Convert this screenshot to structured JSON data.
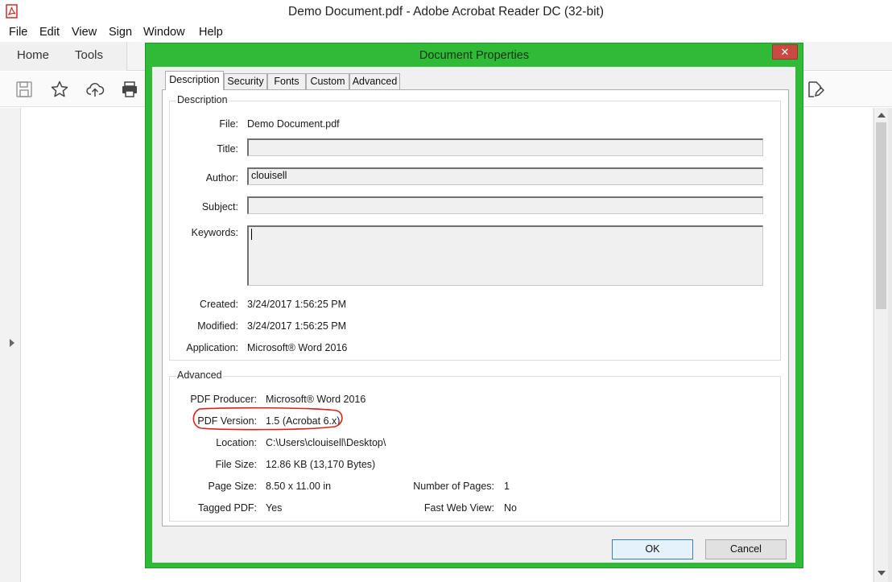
{
  "window": {
    "title": "Demo Document.pdf - Adobe Acrobat Reader DC (32-bit)"
  },
  "menu": [
    "File",
    "Edit",
    "View",
    "Sign",
    "Window",
    "Help"
  ],
  "tabs": {
    "home": "Home",
    "tools": "Tools"
  },
  "toolbar": {
    "icons": [
      "save-icon",
      "star-icon",
      "upload-cloud-icon",
      "print-icon",
      "edit-document-icon"
    ]
  },
  "dialog": {
    "title": "Document Properties",
    "accent_color": "#2fbb37",
    "close_label": "✕",
    "tabs": [
      "Description",
      "Security",
      "Fonts",
      "Custom",
      "Advanced"
    ],
    "active_tab": "Description",
    "description": {
      "group_label": "Description",
      "file_label": "File:",
      "file_value": "Demo Document.pdf",
      "title_label": "Title:",
      "title_value": "",
      "author_label": "Author:",
      "author_value": "clouisell",
      "subject_label": "Subject:",
      "subject_value": "",
      "keywords_label": "Keywords:",
      "keywords_value": "",
      "created_label": "Created:",
      "created_value": "3/24/2017 1:56:25 PM",
      "modified_label": "Modified:",
      "modified_value": "3/24/2017 1:56:25 PM",
      "application_label": "Application:",
      "application_value": "Microsoft® Word 2016"
    },
    "advanced": {
      "group_label": "Advanced",
      "producer_label": "PDF Producer:",
      "producer_value": "Microsoft® Word 2016",
      "version_label": "PDF Version:",
      "version_value": "1.5 (Acrobat 6.x)",
      "location_label": "Location:",
      "location_value": "C:\\Users\\clouisell\\Desktop\\",
      "filesize_label": "File Size:",
      "filesize_value": "12.86 KB (13,170 Bytes)",
      "pagesize_label": "Page Size:",
      "pagesize_value": "8.50 x 11.00 in",
      "numpages_label": "Number of Pages:",
      "numpages_value": "1",
      "tagged_label": "Tagged PDF:",
      "tagged_value": "Yes",
      "fastweb_label": "Fast Web View:",
      "fastweb_value": "No"
    },
    "buttons": {
      "ok": "OK",
      "cancel": "Cancel"
    }
  }
}
